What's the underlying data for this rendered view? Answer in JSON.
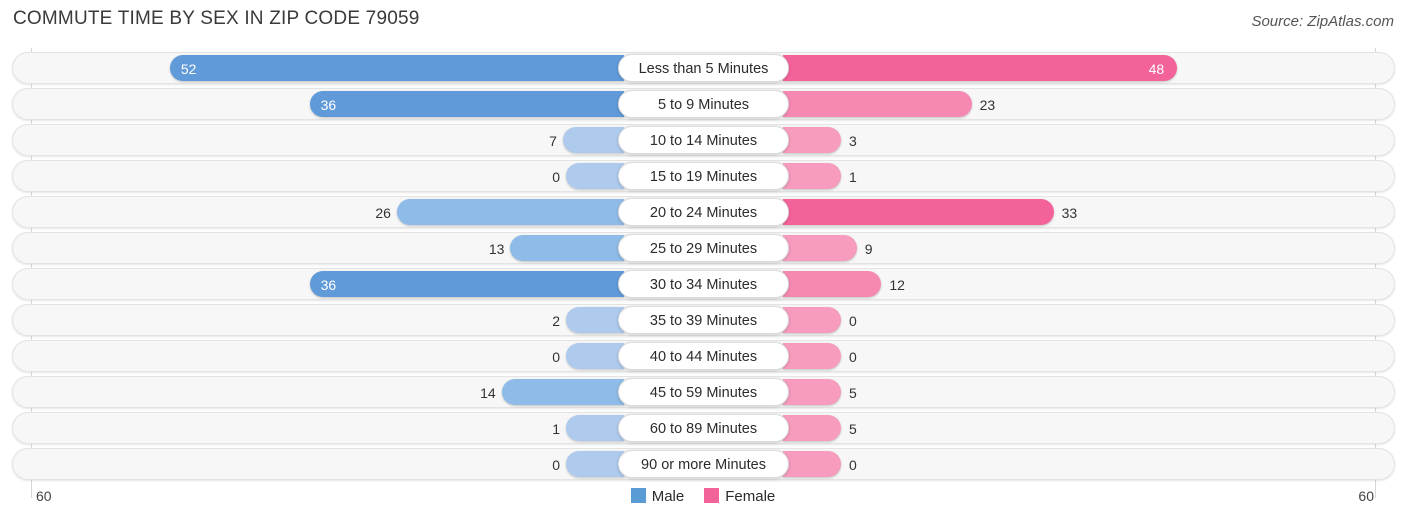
{
  "title": "COMMUTE TIME BY SEX IN ZIP CODE 79059",
  "source": "Source: ZipAtlas.com",
  "legend": [
    {
      "label": "Male",
      "color": "#5b9bd5"
    },
    {
      "label": "Female",
      "color": "#f2639a"
    }
  ],
  "axis": {
    "left": "60",
    "right": "60"
  },
  "chart_data": {
    "type": "bar",
    "title": "COMMUTE TIME BY SEX IN ZIP CODE 79059",
    "subtitle": "Source: ZipAtlas.com",
    "orientation": "horizontal-diverging",
    "xlabel": "",
    "ylabel": "",
    "xlim": [
      60,
      60
    ],
    "grid": true,
    "legend_position": "bottom",
    "categories": [
      "Less than 5 Minutes",
      "5 to 9 Minutes",
      "10 to 14 Minutes",
      "15 to 19 Minutes",
      "20 to 24 Minutes",
      "25 to 29 Minutes",
      "30 to 34 Minutes",
      "35 to 39 Minutes",
      "40 to 44 Minutes",
      "45 to 59 Minutes",
      "60 to 89 Minutes",
      "90 or more Minutes"
    ],
    "series": [
      {
        "name": "Male",
        "color": "#5b9bd5",
        "values": [
          52,
          36,
          7,
          0,
          26,
          13,
          36,
          2,
          0,
          14,
          1,
          0
        ]
      },
      {
        "name": "Female",
        "color": "#f2639a",
        "values": [
          48,
          23,
          3,
          1,
          33,
          9,
          12,
          0,
          0,
          5,
          5,
          0
        ]
      }
    ]
  }
}
